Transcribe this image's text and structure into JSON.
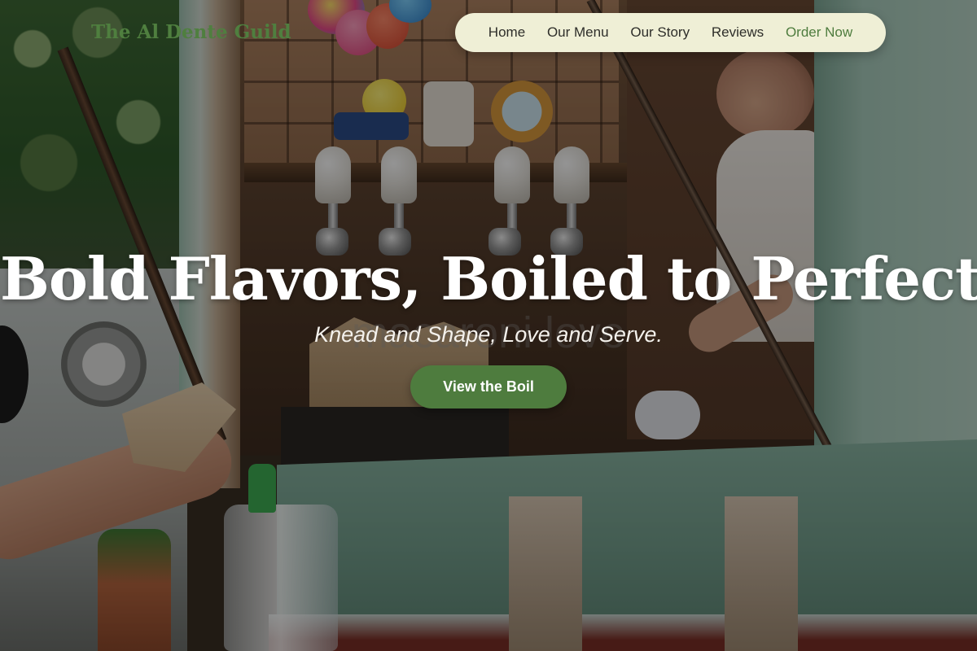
{
  "header": {
    "logo_text": "The Al Dente Guild"
  },
  "nav": {
    "items": [
      {
        "label": "Home"
      },
      {
        "label": "Our Menu"
      },
      {
        "label": "Our Story"
      },
      {
        "label": "Reviews"
      },
      {
        "label": "Order Now"
      }
    ]
  },
  "hero": {
    "title": "Bold Flavors, Boiled to Perfection.",
    "background_watermark": "macaroni love",
    "tagline": "Knead and Shape, Love and Serve.",
    "cta_label": "View the Boil"
  },
  "colors": {
    "accent": "#4e7c3e",
    "nav_background": "#efefd6",
    "hero_text": "#ffffff"
  }
}
